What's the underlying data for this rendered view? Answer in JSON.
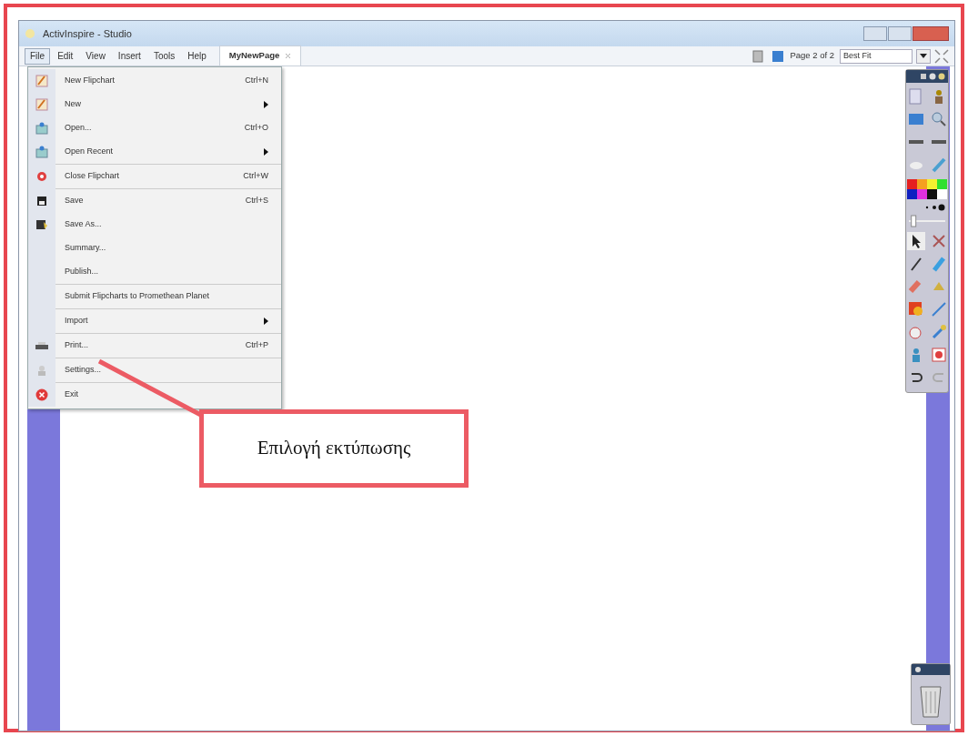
{
  "window": {
    "title": "ActivInspire - Studio"
  },
  "menu_bar": [
    {
      "label": "File",
      "selected": true
    },
    {
      "label": "Edit",
      "selected": false
    },
    {
      "label": "View",
      "selected": false
    },
    {
      "label": "Insert",
      "selected": false
    },
    {
      "label": "Tools",
      "selected": false
    },
    {
      "label": "Help",
      "selected": false
    }
  ],
  "page_tab": {
    "label": "MyNewPage"
  },
  "page_indicator": "Page 2 of 2",
  "zoom_select": {
    "value": "Best Fit"
  },
  "file_menu": [
    {
      "label": "New Flipchart",
      "shortcut": "Ctrl+N",
      "submenu": false,
      "separator_after": false
    },
    {
      "label": "New",
      "submenu": true,
      "separator_after": false
    },
    {
      "label": "Open...",
      "shortcut": "Ctrl+O",
      "submenu": false,
      "separator_after": false
    },
    {
      "label": "Open Recent",
      "submenu": true,
      "separator_after": true
    },
    {
      "label": "Close Flipchart",
      "shortcut": "Ctrl+W",
      "submenu": false,
      "separator_after": true
    },
    {
      "label": "Save",
      "shortcut": "Ctrl+S",
      "submenu": false,
      "separator_after": false
    },
    {
      "label": "Save As...",
      "submenu": false,
      "separator_after": false
    },
    {
      "label": "Summary...",
      "submenu": false,
      "separator_after": false
    },
    {
      "label": "Publish...",
      "submenu": false,
      "separator_after": true
    },
    {
      "label": "Submit Flipcharts to Promethean Planet",
      "submenu": false,
      "separator_after": true
    },
    {
      "label": "Import",
      "submenu": true,
      "separator_after": true
    },
    {
      "label": "Print...",
      "shortcut": "Ctrl+P",
      "submenu": false,
      "separator_after": true
    },
    {
      "label": "Settings...",
      "submenu": false,
      "separator_after": true
    },
    {
      "label": "Exit",
      "submenu": false,
      "separator_after": false
    }
  ],
  "palette": [
    {
      "color": "#e52020"
    },
    {
      "color": "#f5a020"
    },
    {
      "color": "#f2f030"
    },
    {
      "color": "#30e030"
    },
    {
      "color": "#1020c0"
    },
    {
      "color": "#e030e0"
    },
    {
      "color": "#101010"
    },
    {
      "color": "#ffffff"
    }
  ],
  "width_slider": {
    "level": 0.05
  },
  "callout": {
    "text": "Επιλογή εκτύπωσης"
  }
}
